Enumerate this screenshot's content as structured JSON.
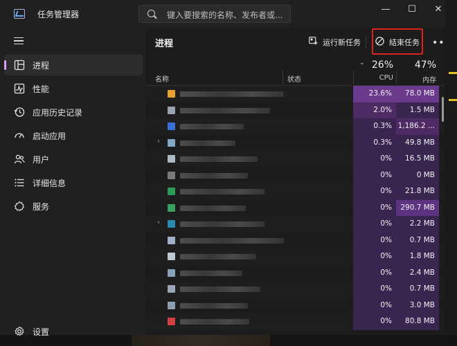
{
  "window": {
    "title": "任务管理器",
    "search_placeholder": "键入要搜索的名称、发布者或...",
    "controls": {
      "minimize": "—",
      "maximize": "☐",
      "close": "✕"
    }
  },
  "sidebar": {
    "items": [
      {
        "label": "进程",
        "icon": "processes-icon",
        "active": true
      },
      {
        "label": "性能",
        "icon": "performance-icon"
      },
      {
        "label": "应用历史记录",
        "icon": "app-history-icon"
      },
      {
        "label": "启动应用",
        "icon": "startup-apps-icon"
      },
      {
        "label": "用户",
        "icon": "users-icon"
      },
      {
        "label": "详细信息",
        "icon": "details-icon"
      },
      {
        "label": "服务",
        "icon": "services-icon"
      }
    ],
    "settings_label": "设置"
  },
  "main": {
    "title": "进程",
    "toolbar": {
      "run_new_task": "运行新任务",
      "end_task": "结束任务",
      "more": "•••"
    },
    "columns": {
      "name": "名称",
      "status": "状态",
      "cpu_pct": "26%",
      "cpu_label": "CPU",
      "mem_pct": "47%",
      "mem_label": "内存"
    },
    "rows": [
      {
        "cpu": "23.6%",
        "mem": "78.0 MB"
      },
      {
        "cpu": "2.0%",
        "mem": "1.5 MB"
      },
      {
        "cpu": "0.3%",
        "mem": "1,186.2 ..."
      },
      {
        "cpu": "0.3%",
        "mem": "49.8 MB",
        "expandable": true
      },
      {
        "cpu": "0%",
        "mem": "16.5 MB"
      },
      {
        "cpu": "0%",
        "mem": "0 MB"
      },
      {
        "cpu": "0%",
        "mem": "21.8 MB"
      },
      {
        "cpu": "0%",
        "mem": "290.7 MB"
      },
      {
        "cpu": "0%",
        "mem": "2.2 MB",
        "expandable": true
      },
      {
        "cpu": "0%",
        "mem": "0.7 MB"
      },
      {
        "cpu": "0%",
        "mem": "1.8 MB"
      },
      {
        "cpu": "0%",
        "mem": "2.4 MB"
      },
      {
        "cpu": "0%",
        "mem": "0.7 MB"
      },
      {
        "cpu": "0%",
        "mem": "3.0 MB"
      },
      {
        "cpu": "0%",
        "mem": "80.8 MB"
      }
    ]
  },
  "colors": {
    "accent": "#d6a0ff",
    "highlight_box": "#e0201a",
    "heat_high": "#6b3a8c",
    "heat_mid": "#4f2b66",
    "heat_low": "#3a2450"
  }
}
